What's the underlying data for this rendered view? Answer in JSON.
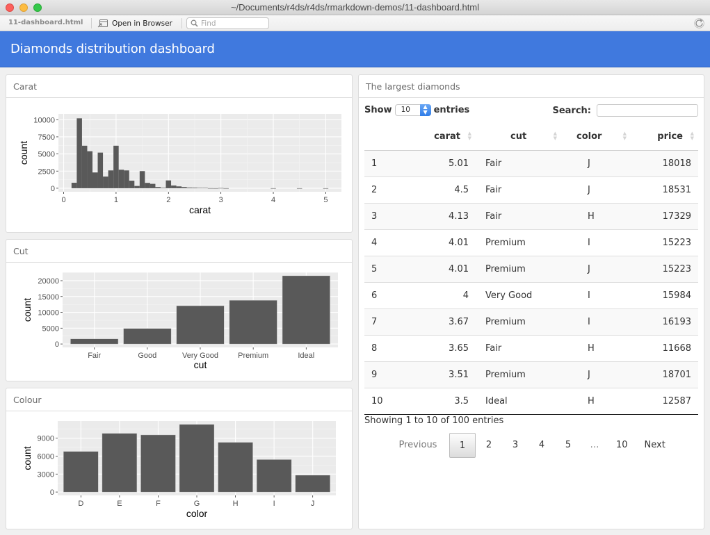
{
  "window": {
    "title": "~/Documents/r4ds/r4ds/rmarkdown-demos/11-dashboard.html"
  },
  "toolbar": {
    "file_name": "11-dashboard.html",
    "open_in_browser_label": "Open in Browser",
    "find_placeholder": "Find",
    "find_value": ""
  },
  "navbar": {
    "title": "Diamonds distribution dashboard"
  },
  "panels": {
    "carat": {
      "title": "Carat"
    },
    "cut": {
      "title": "Cut"
    },
    "colour": {
      "title": "Colour"
    },
    "largest": {
      "title": "The largest diamonds"
    }
  },
  "chart_data": [
    {
      "type": "bar",
      "subtype": "histogram",
      "title": "",
      "xlabel": "carat",
      "ylabel": "count",
      "xlim": [
        -0.1,
        5.3
      ],
      "ylim": [
        -516,
        10840
      ],
      "x_ticks": [
        0,
        1,
        2,
        3,
        4,
        5
      ],
      "y_ticks": [
        0,
        2500,
        5000,
        7500,
        10000
      ],
      "bin_width": 0.1,
      "bins": [
        {
          "x0": 0.15,
          "count": 800
        },
        {
          "x0": 0.25,
          "count": 10200
        },
        {
          "x0": 0.35,
          "count": 6200
        },
        {
          "x0": 0.45,
          "count": 5400
        },
        {
          "x0": 0.55,
          "count": 2300
        },
        {
          "x0": 0.65,
          "count": 5200
        },
        {
          "x0": 0.75,
          "count": 1700
        },
        {
          "x0": 0.85,
          "count": 2600
        },
        {
          "x0": 0.95,
          "count": 6200
        },
        {
          "x0": 1.05,
          "count": 2700
        },
        {
          "x0": 1.15,
          "count": 2600
        },
        {
          "x0": 1.25,
          "count": 1100
        },
        {
          "x0": 1.35,
          "count": 330
        },
        {
          "x0": 1.45,
          "count": 2500
        },
        {
          "x0": 1.55,
          "count": 780
        },
        {
          "x0": 1.65,
          "count": 640
        },
        {
          "x0": 1.75,
          "count": 170
        },
        {
          "x0": 1.85,
          "count": 70
        },
        {
          "x0": 1.95,
          "count": 1140
        },
        {
          "x0": 2.05,
          "count": 400
        },
        {
          "x0": 2.15,
          "count": 270
        },
        {
          "x0": 2.25,
          "count": 170
        },
        {
          "x0": 2.35,
          "count": 100
        },
        {
          "x0": 2.45,
          "count": 90
        },
        {
          "x0": 2.55,
          "count": 50
        },
        {
          "x0": 2.65,
          "count": 50
        },
        {
          "x0": 2.75,
          "count": 10
        },
        {
          "x0": 2.85,
          "count": 5
        },
        {
          "x0": 2.95,
          "count": 30
        },
        {
          "x0": 3.05,
          "count": 5
        },
        {
          "x0": 3.95,
          "count": 3
        },
        {
          "x0": 4.45,
          "count": 1
        },
        {
          "x0": 4.95,
          "count": 1
        }
      ],
      "grid": true,
      "legend": "none"
    },
    {
      "type": "bar",
      "title": "",
      "xlabel": "cut",
      "ylabel": "count",
      "categories": [
        "Fair",
        "Good",
        "Very Good",
        "Premium",
        "Ideal"
      ],
      "values": [
        1610,
        4906,
        12082,
        13791,
        21551
      ],
      "ylim": [
        -1078,
        22629
      ],
      "y_ticks": [
        0,
        5000,
        10000,
        15000,
        20000
      ],
      "grid": true,
      "legend": "none"
    },
    {
      "type": "bar",
      "title": "",
      "xlabel": "color",
      "ylabel": "count",
      "categories": [
        "D",
        "E",
        "F",
        "G",
        "H",
        "I",
        "J"
      ],
      "values": [
        6775,
        9797,
        9542,
        11292,
        8304,
        5422,
        2808
      ],
      "ylim": [
        -565,
        11857
      ],
      "y_ticks": [
        0,
        3000,
        6000,
        9000
      ],
      "grid": true,
      "legend": "none"
    }
  ],
  "datatable": {
    "length_label_before": "Show",
    "length_value": "10",
    "length_label_after": "entries",
    "search_label": "Search:",
    "search_value": "",
    "columns": [
      "",
      "carat",
      "cut",
      "color",
      "price"
    ],
    "rows": [
      [
        "1",
        "5.01",
        "Fair",
        "J",
        "18018"
      ],
      [
        "2",
        "4.5",
        "Fair",
        "J",
        "18531"
      ],
      [
        "3",
        "4.13",
        "Fair",
        "H",
        "17329"
      ],
      [
        "4",
        "4.01",
        "Premium",
        "I",
        "15223"
      ],
      [
        "5",
        "4.01",
        "Premium",
        "J",
        "15223"
      ],
      [
        "6",
        "4",
        "Very Good",
        "I",
        "15984"
      ],
      [
        "7",
        "3.67",
        "Premium",
        "I",
        "16193"
      ],
      [
        "8",
        "3.65",
        "Fair",
        "H",
        "11668"
      ],
      [
        "9",
        "3.51",
        "Premium",
        "J",
        "18701"
      ],
      [
        "10",
        "3.5",
        "Ideal",
        "H",
        "12587"
      ]
    ],
    "info": "Showing 1 to 10 of 100 entries",
    "pagination": {
      "previous": "Previous",
      "pages": [
        "1",
        "2",
        "3",
        "4",
        "5",
        "…",
        "10"
      ],
      "current": "1",
      "next": "Next"
    }
  },
  "colors": {
    "navbar": "#4079de",
    "bar_fill": "#595959",
    "plot_bg": "#ebebeb"
  }
}
